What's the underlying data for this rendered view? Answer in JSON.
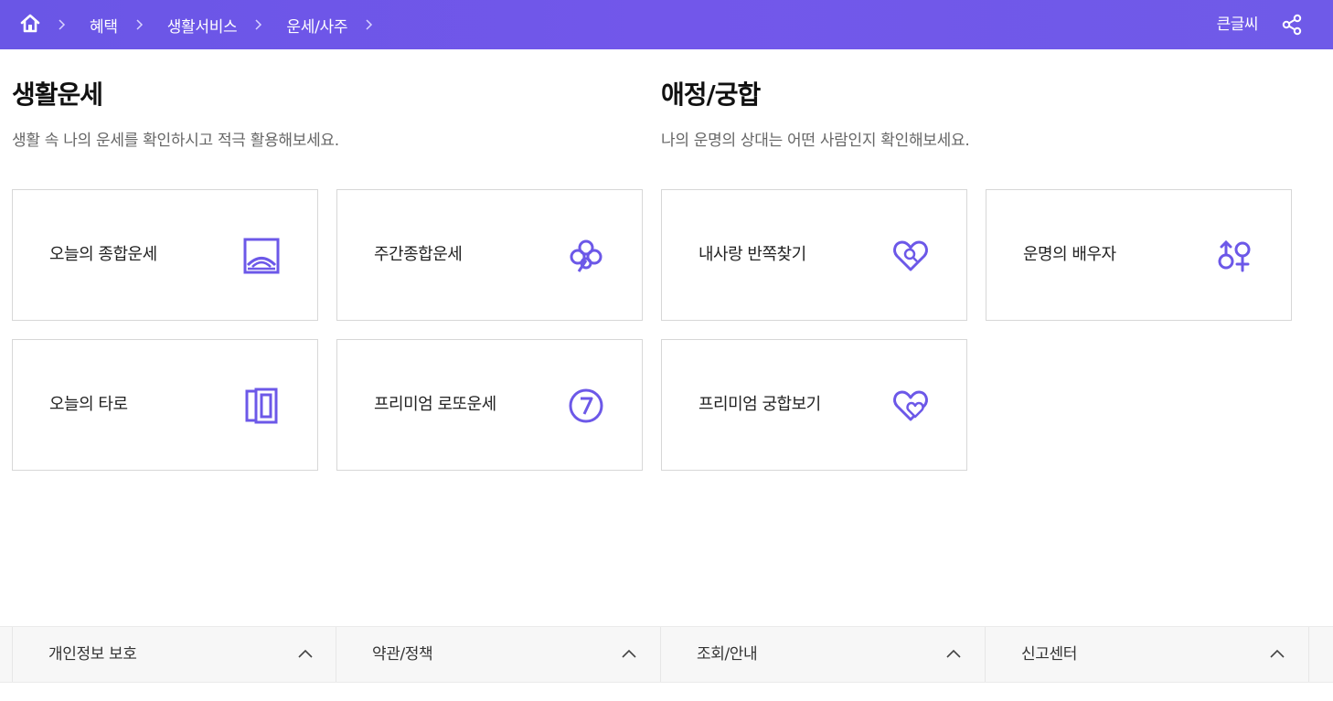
{
  "topbar": {
    "home_icon": "home-icon",
    "breadcrumbs": [
      {
        "label": "혜택"
      },
      {
        "label": "생활서비스"
      },
      {
        "label": "운세/사주"
      }
    ],
    "big_text_label": "큰글씨",
    "share_icon": "share-icon",
    "bg_color": "#6c58e8"
  },
  "sections": [
    {
      "title": "생활운세",
      "description": "생활 속 나의 운세를 확인하시고 적극 활용해보세요.",
      "cards": [
        {
          "label": "오늘의 종합운세",
          "icon": "sunrise-frame-icon"
        },
        {
          "label": "주간종합운세",
          "icon": "clover-icon"
        },
        {
          "label": "오늘의 타로",
          "icon": "tarot-cards-icon"
        },
        {
          "label": "프리미엄 로또운세",
          "icon": "lucky-seven-icon"
        }
      ]
    },
    {
      "title": "애정/궁합",
      "description": "나의 운명의 상대는 어떤 사람인지 확인해보세요.",
      "cards": [
        {
          "label": "내사랑 반쪽찾기",
          "icon": "heart-search-icon"
        },
        {
          "label": "운명의 배우자",
          "icon": "gender-symbols-icon"
        },
        {
          "label": "프리미엄 궁합보기",
          "icon": "double-heart-icon"
        }
      ]
    }
  ],
  "footer": {
    "items": [
      {
        "label": "개인정보 보호"
      },
      {
        "label": "약관/정책"
      },
      {
        "label": "조회/안내"
      },
      {
        "label": "신고센터"
      }
    ]
  },
  "colors": {
    "accent": "#6c58e8",
    "card_border": "#d7d7d7",
    "footer_bg": "#f7f7f7"
  }
}
